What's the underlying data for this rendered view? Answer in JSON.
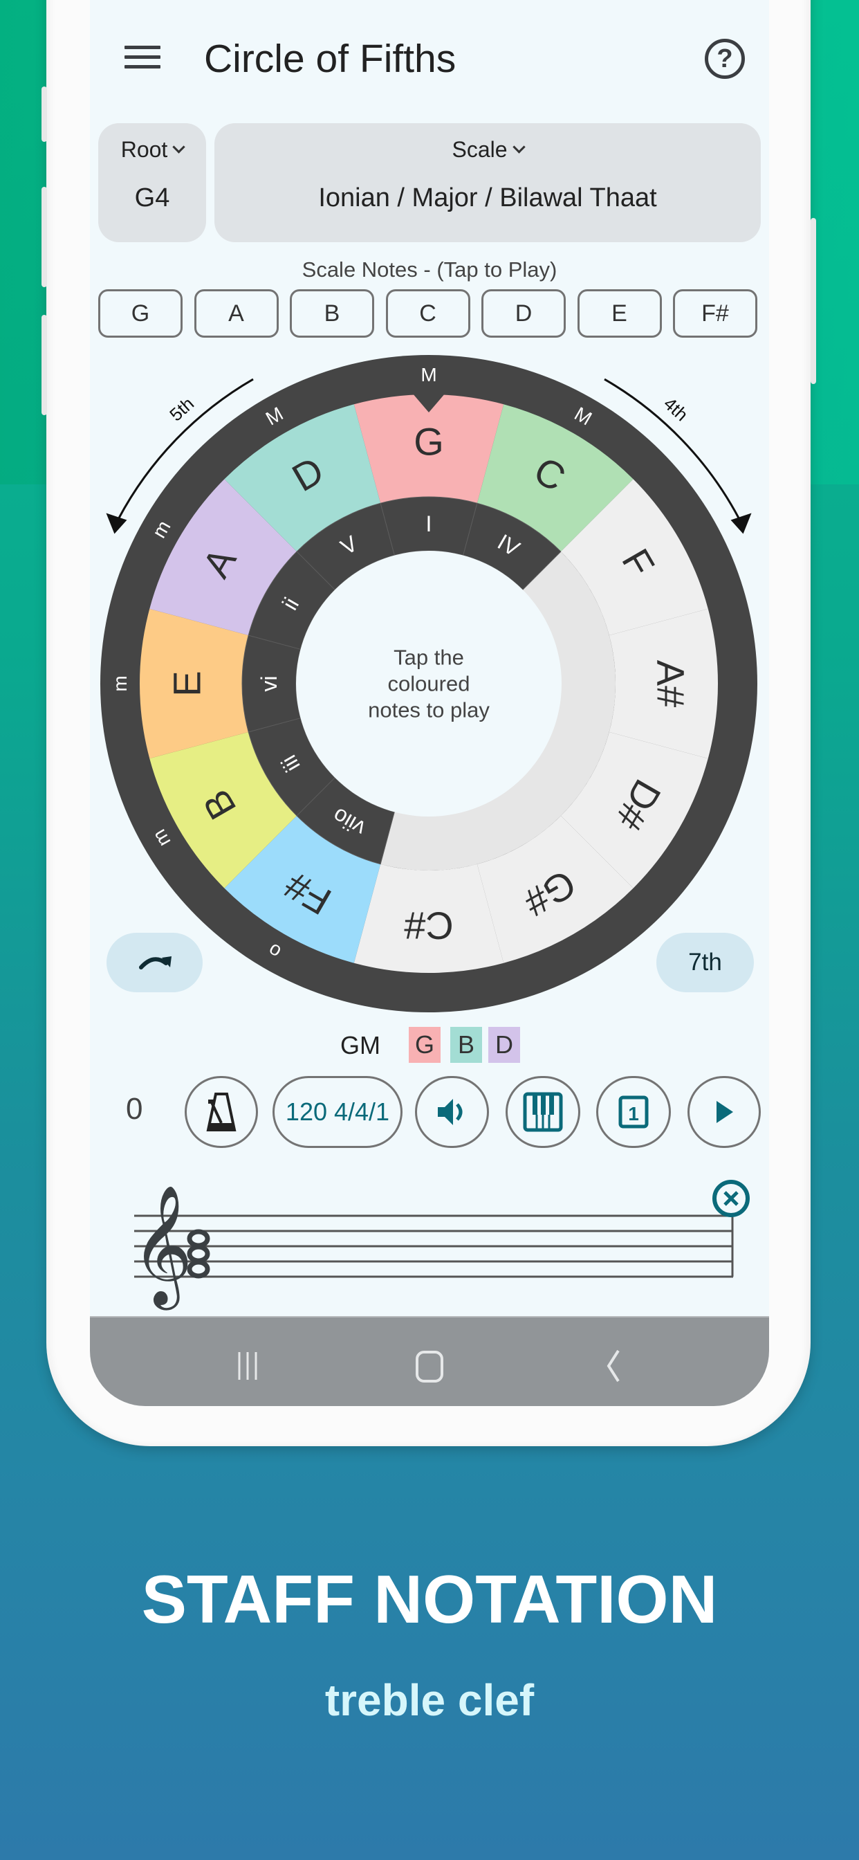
{
  "header": {
    "title": "Circle of Fifths",
    "menu_icon": "hamburger-menu-icon",
    "help_icon": "help-circle-icon",
    "help_glyph": "?"
  },
  "root_selector": {
    "label": "Root",
    "value": "G4"
  },
  "scale_selector": {
    "label": "Scale",
    "value": "Ionian / Major / Bilawal Thaat"
  },
  "scale_notes": {
    "label": "Scale Notes - (Tap to Play)",
    "notes": [
      "G",
      "A",
      "B",
      "C",
      "D",
      "E",
      "F#"
    ]
  },
  "circle": {
    "center_text_lines": [
      "Tap the",
      "coloured",
      "notes to play"
    ],
    "fifth_label": "5th",
    "fourth_label": "4th",
    "segments": [
      {
        "note": "G",
        "quality": "M",
        "numeral": "I",
        "color": "#f8b1b3",
        "active": true
      },
      {
        "note": "C",
        "quality": "M",
        "numeral": "IV",
        "color": "#b0e0b4",
        "active": true
      },
      {
        "note": "F",
        "quality": "",
        "numeral": "",
        "color": "#efefef",
        "active": false
      },
      {
        "note": "A#",
        "quality": "",
        "numeral": "",
        "color": "#efefef",
        "active": false
      },
      {
        "note": "D#",
        "quality": "",
        "numeral": "",
        "color": "#efefef",
        "active": false
      },
      {
        "note": "G#",
        "quality": "",
        "numeral": "",
        "color": "#efefef",
        "active": false
      },
      {
        "note": "C#",
        "quality": "",
        "numeral": "",
        "color": "#efefef",
        "active": false
      },
      {
        "note": "F#",
        "quality": "o",
        "numeral": "viio",
        "color": "#9cdcfb",
        "active": true
      },
      {
        "note": "B",
        "quality": "m",
        "numeral": "iii",
        "color": "#e6ee84",
        "active": true
      },
      {
        "note": "E",
        "quality": "m",
        "numeral": "vi",
        "color": "#fdcb86",
        "active": true
      },
      {
        "note": "A",
        "quality": "m",
        "numeral": "ii",
        "color": "#d3c3ea",
        "active": true
      },
      {
        "note": "D",
        "quality": "M",
        "numeral": "V",
        "color": "#a3ddd4",
        "active": true
      }
    ]
  },
  "rotate_button": {
    "icon": "rotate-clockwise-icon"
  },
  "seventh_button": {
    "label": "7th"
  },
  "chord": {
    "name": "GM",
    "notes": [
      {
        "note": "G",
        "color": "#f8b1b3"
      },
      {
        "note": "B",
        "color": "#a3ddd4"
      },
      {
        "note": "D",
        "color": "#d3c3ea"
      }
    ]
  },
  "transport": {
    "counter": "0",
    "tempo": "120 4/4/1",
    "metronome_icon": "metronome-icon",
    "speaker_icon": "speaker-icon",
    "piano_icon": "piano-keyboard-icon",
    "bar_icon": "bar-one-icon",
    "bar_number": "1",
    "play_icon": "play-icon",
    "accent_color": "#0b6a7a"
  },
  "staff": {
    "clef": "treble",
    "chord_notes": [
      "G4",
      "B4",
      "D5"
    ],
    "clear_icon": "close-circle-icon"
  },
  "navbar": {
    "recents_icon": "recent-apps-icon",
    "home_icon": "home-icon",
    "back_icon": "back-icon"
  },
  "caption": {
    "title": "STAFF NOTATION",
    "subtitle": "treble clef"
  }
}
